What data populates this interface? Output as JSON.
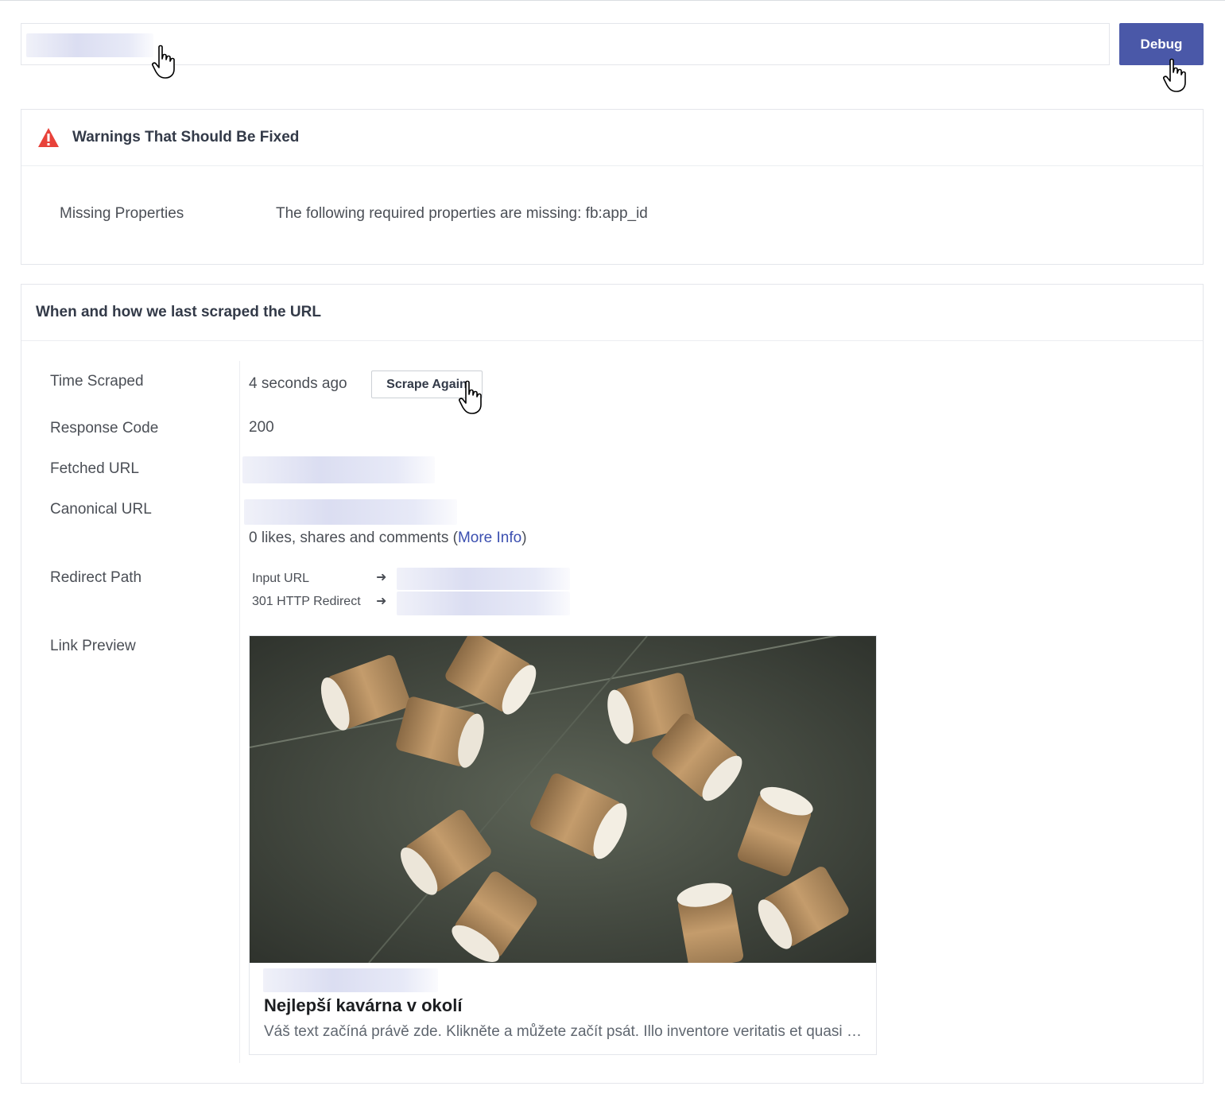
{
  "debugger": {
    "debug_button_label": "Debug"
  },
  "warnings": {
    "title": "Warnings That Should Be Fixed",
    "items": [
      {
        "label": "Missing Properties",
        "text": "The following required properties are missing: fb:app_id"
      }
    ]
  },
  "scrape": {
    "title": "When and how we last scraped the URL",
    "time_scraped_label": "Time Scraped",
    "time_scraped_value": "4 seconds ago",
    "scrape_again_label": "Scrape Again",
    "response_code_label": "Response Code",
    "response_code_value": "200",
    "fetched_url_label": "Fetched URL",
    "canonical_url_label": "Canonical URL",
    "engagement_text": "0 likes, shares and comments (",
    "more_info_label": "More Info",
    "engagement_close": ")",
    "redirect_path_label": "Redirect Path",
    "redirects": [
      {
        "label": "Input URL",
        "arrow": "➜"
      },
      {
        "label": "301 HTTP Redirect",
        "arrow": "➜"
      }
    ],
    "link_preview_label": "Link Preview"
  },
  "preview": {
    "title": "Nejlepší kavárna v okolí",
    "description": "Váš text začíná právě zde. Klikněte a můžete začít psát. Illo inventore veritatis et quasi architecto beatae vitae dicta sunt explicabo."
  },
  "colors": {
    "accent": "#4a58a8",
    "link": "#3b4fb0",
    "warning": "#e8423a"
  }
}
